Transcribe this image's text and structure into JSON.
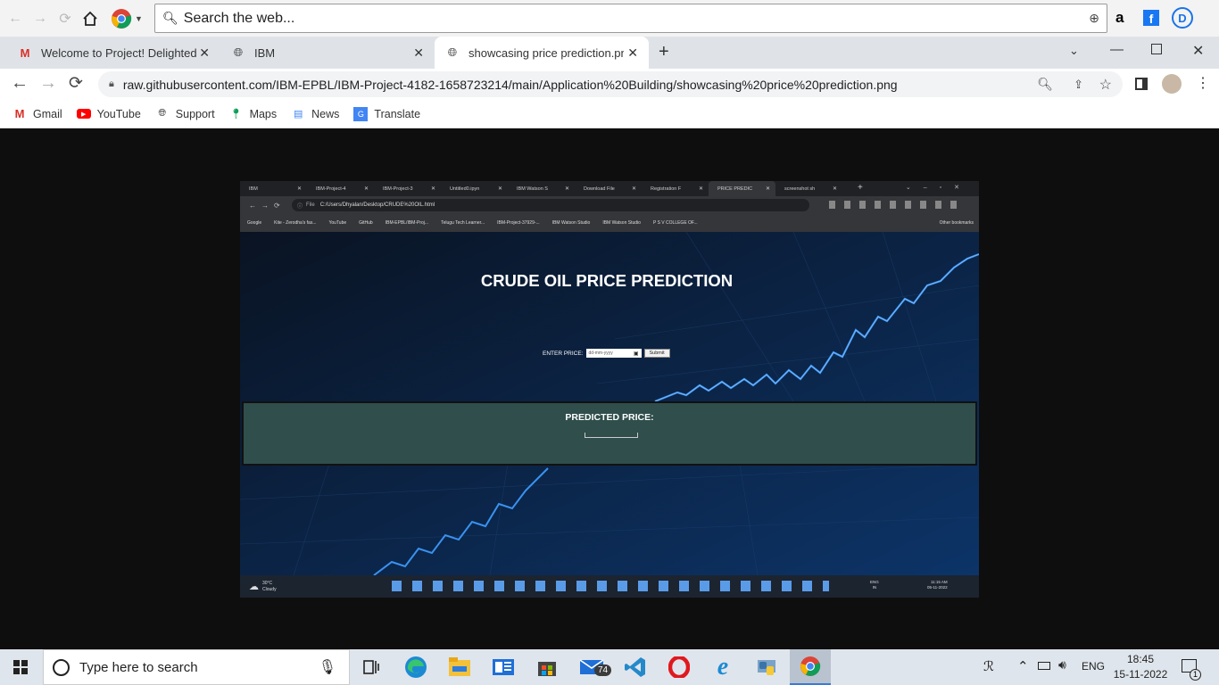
{
  "top_search": {
    "placeholder": "Search the web..."
  },
  "tabs": [
    {
      "label": "Welcome to Project! Delighted to"
    },
    {
      "label": "IBM"
    },
    {
      "label": "showcasing price prediction.png"
    }
  ],
  "address": {
    "url": "raw.githubusercontent.com/IBM-EPBL/IBM-Project-4182-1658723214/main/Application%20Building/showcasing%20price%20prediction.png"
  },
  "bookmarks": [
    "Gmail",
    "YouTube",
    "Support",
    "Maps",
    "News",
    "Translate"
  ],
  "inner": {
    "tabs": [
      "IBM",
      "IBM-Project-4",
      "IBM-Project-3",
      "Untitled0.ipyn",
      "IBM Watson S",
      "Download File",
      "Registration F",
      "PRICE PREDIC",
      "screenshot sh"
    ],
    "url": "C:/Users/Dhyalan/Desktop/CRUDE%20OIL.html",
    "url_prefix": "File",
    "bookmarks": [
      "Google",
      "Kite - Zerodha's fas...",
      "YouTube",
      "GitHub",
      "IBM-EPBL/IBM-Proj...",
      "Telugu Tech Learner...",
      "IBM-Project-37929-...",
      "IBM Watson Studio",
      "IBM Watson Studio",
      "P S V COLLEGE OF..."
    ],
    "other_bookmarks": "Other bookmarks",
    "title": "CRUDE OIL PRICE PREDICTION",
    "enter_label": "ENTER PRICE:",
    "date_placeholder": "dd-mm-yyyy",
    "submit": "Submit",
    "predicted_label": "PREDICTED PRICE:",
    "weather_temp": "30°C",
    "weather_text": "Cloudy",
    "sys_lang": "ENG",
    "sys_region": "IN",
    "sys_time": "11:15 AM",
    "sys_date": "05-11-2022"
  },
  "taskbar": {
    "search_placeholder": "Type here to search",
    "mail_badge": "74",
    "lang": "ENG",
    "time": "18:45",
    "date": "15-11-2022",
    "notifications": "1"
  },
  "colors": {
    "chrome_tab": "#dfe3e8",
    "result_panel": "#2f4e4c",
    "chart_line": "#2a7fe0"
  }
}
